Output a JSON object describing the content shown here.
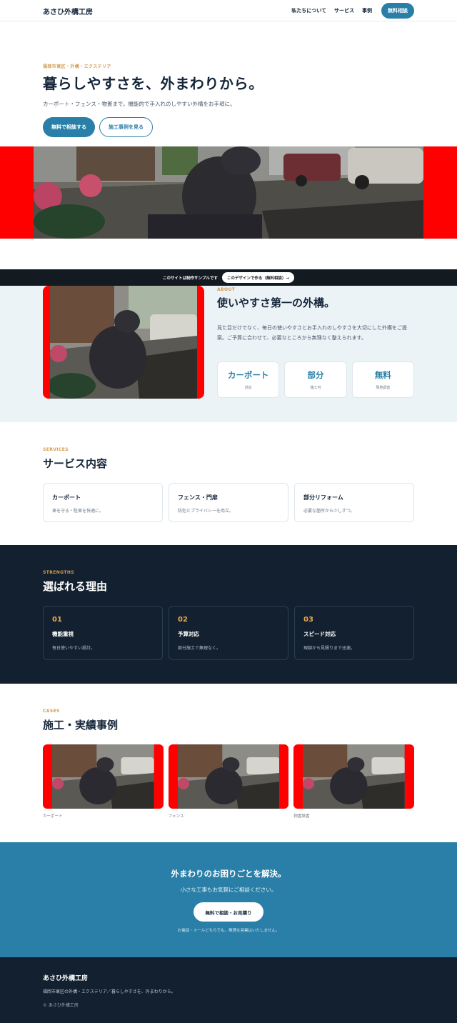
{
  "header": {
    "logo": "あさひ外構工房",
    "nav": [
      "私たちについて",
      "サービス",
      "事例"
    ],
    "cta": "無料相談"
  },
  "hero": {
    "eyebrow": "福岡市東区・外構・エクステリア",
    "title": "暮らしやすさを、外まわりから。",
    "subtitle": "カーポート・フェンス・物置まで。機能的で手入れのしやすい外構をお手頃に。",
    "primary_button": "無料で相談する",
    "secondary_button": "施工事例を見る"
  },
  "sample_bar": {
    "text": "このサイトは制作サンプルです",
    "button": "このデザインで作る（無料相談）→"
  },
  "about": {
    "eyebrow": "ABOUT",
    "title": "使いやすさ第一の外構。",
    "description": "見た目だけでなく、毎日の使いやすさとお手入れのしやすさを大切にした外構をご提案。ご予算に合わせて、必要なところから無理なく整えられます。",
    "stats": [
      {
        "value": "カーポート",
        "label": "対応"
      },
      {
        "value": "部分",
        "label": "施工可"
      },
      {
        "value": "無料",
        "label": "現地調査"
      }
    ]
  },
  "services": {
    "eyebrow": "SERVICES",
    "title": "サービス内容",
    "items": [
      {
        "title": "カーポート",
        "desc": "車を守る・駐車を快適に。"
      },
      {
        "title": "フェンス・門扉",
        "desc": "防犯とプライバシーを両立。"
      },
      {
        "title": "部分リフォーム",
        "desc": "必要な箇所から少しずつ。"
      }
    ]
  },
  "strengths": {
    "eyebrow": "STRENGTHS",
    "title": "選ばれる理由",
    "items": [
      {
        "num": "01",
        "title": "機能重視",
        "desc": "毎日使いやすい設計。"
      },
      {
        "num": "02",
        "title": "予算対応",
        "desc": "部分施工で無理なく。"
      },
      {
        "num": "03",
        "title": "スピード対応",
        "desc": "現調から見積りまで迅速。"
      }
    ]
  },
  "cases": {
    "eyebrow": "CASES",
    "title": "施工・実績事例",
    "items": [
      {
        "label": "カーポート"
      },
      {
        "label": "フェンス"
      },
      {
        "label": "物置設置"
      }
    ]
  },
  "cta": {
    "title": "外まわりのお困りごとを解決。",
    "subtitle": "小さな工事もお気軽にご相談ください。",
    "button": "無料で相談・お見積り",
    "note": "お電話・メールどちらでも。無理な営業はいたしません。"
  },
  "footer": {
    "logo": "あさひ外構工房",
    "description": "福岡市東区の外構・エクステリア／暮らしやすさを、外まわりから。",
    "copyright": "© あさひ外構工房"
  },
  "colors": {
    "accent": "#2a7fa8",
    "eyebrow": "#d39b52",
    "dark": "#12202f",
    "placeholder": "#ff0000"
  }
}
